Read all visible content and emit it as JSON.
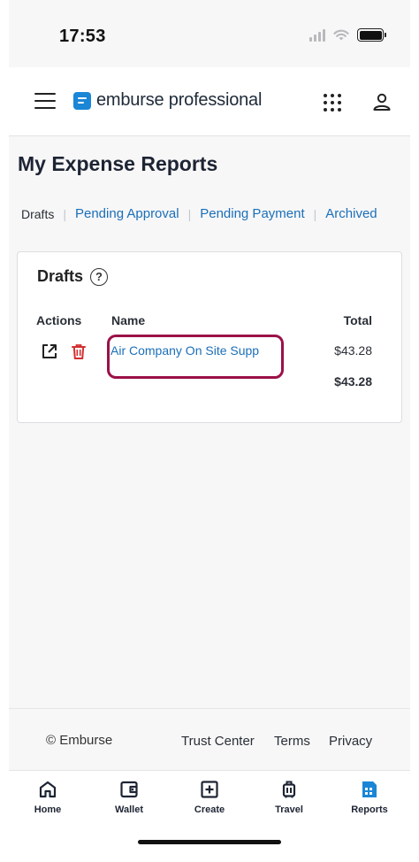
{
  "status_bar": {
    "time": "17:53"
  },
  "header": {
    "brand": "emburse professional"
  },
  "page": {
    "title": "My Expense Reports",
    "tabs": [
      {
        "label": "Drafts",
        "active": true
      },
      {
        "label": "Pending Approval",
        "active": false
      },
      {
        "label": "Pending Payment",
        "active": false
      },
      {
        "label": "Archived",
        "active": false
      }
    ]
  },
  "drafts_card": {
    "title": "Drafts",
    "help_symbol": "?",
    "columns": {
      "actions": "Actions",
      "name": "Name",
      "total": "Total"
    },
    "rows": [
      {
        "name": "Air Company On Site Supp",
        "total": "$43.28"
      }
    ],
    "grand_total": "$43.28"
  },
  "footer": {
    "copyright": "© Emburse",
    "links": [
      "Trust Center",
      "Terms",
      "Privacy"
    ]
  },
  "bottom_nav": [
    {
      "label": "Home",
      "icon": "home-icon"
    },
    {
      "label": "Wallet",
      "icon": "wallet-icon"
    },
    {
      "label": "Create",
      "icon": "add-box-icon"
    },
    {
      "label": "Travel",
      "icon": "luggage-icon"
    },
    {
      "label": "Reports",
      "icon": "reports-icon",
      "active": true
    }
  ],
  "colors": {
    "accent": "#1b6fb8",
    "brand_blue": "#1a86d6",
    "delete_red": "#d32f2f",
    "highlight": "#9b1148"
  }
}
